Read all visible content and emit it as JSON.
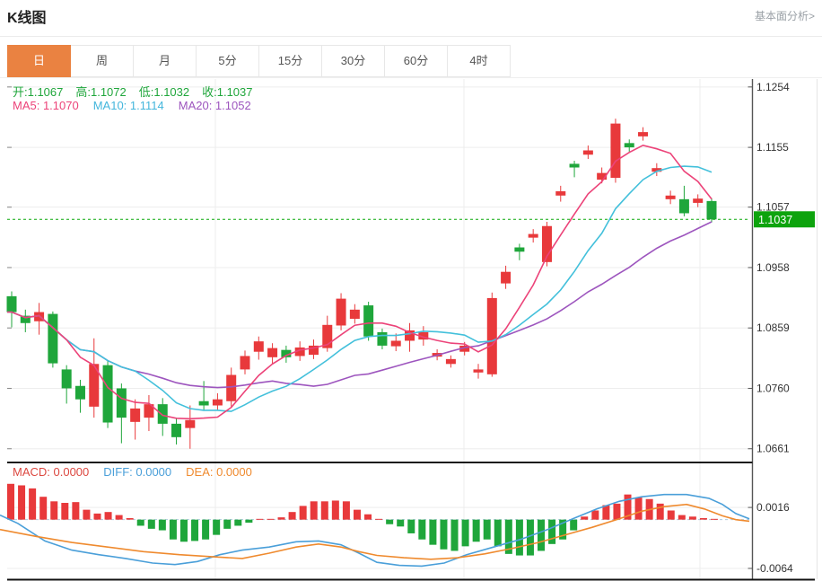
{
  "header": {
    "title": "K线图",
    "link_label": "基本面分析>"
  },
  "tabs": {
    "items": [
      "日",
      "周",
      "月",
      "5分",
      "15分",
      "30分",
      "60分",
      "4时"
    ],
    "active": "日"
  },
  "legend": {
    "ohlc": [
      "开:1.1067",
      "高:1.1072",
      "低:1.1032",
      "收:1.1037"
    ],
    "ma": [
      "MA5: 1.1070",
      "MA10: 1.1114",
      "MA20: 1.1052"
    ]
  },
  "macd_legend": [
    "MACD: 0.0000",
    "DIFF: 0.0000",
    "DEA: 0.0000"
  ],
  "current_price": "1.1037",
  "colors": {
    "up": "#E8393B",
    "down": "#1FA63B",
    "ma5": "#EC4379",
    "ma10": "#43C0DB",
    "ma20": "#9D55BE",
    "diff": "#4A9FD9",
    "dea": "#EF8A2E",
    "tab_active": "#EA8241",
    "price_badge": "#0DA30D",
    "price_line": "#0BA90B",
    "grid": "#ededed",
    "axis": "#555555",
    "label": "#333333",
    "zero_dash": "#AECBDF"
  },
  "chart_data": [
    {
      "type": "candlestick",
      "title": "K线图 日K",
      "ylim": [
        1.064,
        1.1267
      ],
      "y_ticks": [
        1.1254,
        1.1155,
        1.1057,
        1.0958,
        1.0859,
        1.076,
        1.0661
      ],
      "y_tick_labels": [
        "1.1254",
        "1.1155",
        "1.1057",
        "1.0958",
        "1.0859",
        "1.0760",
        "1.0661"
      ],
      "current_price": 1.1037,
      "ma_periods": [
        5,
        10,
        20
      ],
      "last_ohlc": {
        "open": 1.1067,
        "high": 1.1072,
        "low": 1.1032,
        "close": 1.1037
      },
      "ohlc": [
        [
          1.0911,
          1.0919,
          1.086,
          1.0885
        ],
        [
          1.0879,
          1.0889,
          1.0852,
          1.0867
        ],
        [
          1.087,
          1.09,
          1.0848,
          1.0885
        ],
        [
          1.0882,
          1.0886,
          1.0794,
          1.0801
        ],
        [
          1.0791,
          1.0798,
          1.0735,
          1.076
        ],
        [
          1.0764,
          1.0774,
          1.072,
          1.0742
        ],
        [
          1.073,
          1.0842,
          1.0712,
          1.08
        ],
        [
          1.0798,
          1.0806,
          1.0695,
          1.0704
        ],
        [
          1.076,
          1.0768,
          1.067,
          1.0712
        ],
        [
          1.0705,
          1.0742,
          1.0676,
          1.0727
        ],
        [
          1.0712,
          1.0749,
          1.069,
          1.0734
        ],
        [
          1.0734,
          1.0744,
          1.0682,
          1.0702
        ],
        [
          1.0702,
          1.0712,
          1.0668,
          1.068
        ],
        [
          1.0695,
          1.0732,
          1.0661,
          1.0708
        ],
        [
          1.0739,
          1.0772,
          1.0723,
          1.0732
        ],
        [
          1.0732,
          1.0752,
          1.0724,
          1.0742
        ],
        [
          1.0739,
          1.0794,
          1.073,
          1.0782
        ],
        [
          1.0791,
          1.0822,
          1.0783,
          1.0813
        ],
        [
          1.082,
          1.0845,
          1.0807,
          1.0837
        ],
        [
          1.0811,
          1.0834,
          1.08,
          1.0826
        ],
        [
          1.0823,
          1.083,
          1.0802,
          1.0811
        ],
        [
          1.0813,
          1.0837,
          1.0805,
          1.0827
        ],
        [
          1.0815,
          1.084,
          1.0808,
          1.083
        ],
        [
          1.0826,
          1.0879,
          1.082,
          1.0864
        ],
        [
          1.0863,
          1.0916,
          1.0855,
          1.0907
        ],
        [
          1.0874,
          1.0898,
          1.0866,
          1.0889
        ],
        [
          1.0896,
          1.0902,
          1.0838,
          1.0845
        ],
        [
          1.0852,
          1.0858,
          1.0824,
          1.083
        ],
        [
          1.0829,
          1.085,
          1.0821,
          1.0838
        ],
        [
          1.0838,
          1.0867,
          1.082,
          1.0855
        ],
        [
          1.084,
          1.0862,
          1.083,
          1.0852
        ],
        [
          1.0812,
          1.0824,
          1.0806,
          1.0818
        ],
        [
          1.08,
          1.0814,
          1.0794,
          1.0808
        ],
        [
          1.082,
          1.0836,
          1.0814,
          1.083
        ],
        [
          1.0786,
          1.08,
          1.0776,
          1.0791
        ],
        [
          1.0783,
          1.0917,
          1.0779,
          1.0908
        ],
        [
          1.0932,
          1.0961,
          1.0923,
          1.0951
        ],
        [
          1.0991,
          1.0997,
          1.097,
          1.0984
        ],
        [
          1.1007,
          1.1021,
          1.0999,
          1.1013
        ],
        [
          1.0967,
          1.1033,
          1.096,
          1.1026
        ],
        [
          1.1076,
          1.1092,
          1.1066,
          1.1083
        ],
        [
          1.1128,
          1.1133,
          1.1106,
          1.1122
        ],
        [
          1.1143,
          1.1158,
          1.1136,
          1.115
        ],
        [
          1.1102,
          1.1122,
          1.1096,
          1.1113
        ],
        [
          1.1105,
          1.1202,
          1.1097,
          1.1194
        ],
        [
          1.1162,
          1.1168,
          1.1148,
          1.1155
        ],
        [
          1.1173,
          1.1188,
          1.1166,
          1.118
        ],
        [
          1.1115,
          1.1129,
          1.1108,
          1.1121
        ],
        [
          1.107,
          1.1084,
          1.1062,
          1.1076
        ],
        [
          1.107,
          1.1092,
          1.1042,
          1.1047
        ],
        [
          1.1064,
          1.1078,
          1.1057,
          1.1071
        ],
        [
          1.1067,
          1.1072,
          1.1032,
          1.1037
        ]
      ]
    },
    {
      "type": "bar",
      "name": "MACD",
      "ylim": [
        -0.0077,
        0.0055
      ],
      "y_ticks": [
        0.0016,
        -0.0064
      ],
      "y_tick_labels": [
        "0.0016",
        "-0.0064"
      ],
      "values": [
        0.0047,
        0.0045,
        0.0041,
        0.003,
        0.0024,
        0.0022,
        0.0023,
        0.0013,
        0.0008,
        0.001,
        0.0006,
        0.0002,
        -0.0008,
        -0.0012,
        -0.0014,
        -0.0026,
        -0.0029,
        -0.0028,
        -0.0026,
        -0.002,
        -0.0012,
        -0.0008,
        -0.0004,
        0.0001,
        0.0001,
        0.0003,
        0.001,
        0.0018,
        0.0024,
        0.0024,
        0.0025,
        0.0024,
        0.0013,
        0.0007,
        0.0001,
        -0.0006,
        -0.0009,
        -0.0018,
        -0.0026,
        -0.0033,
        -0.0039,
        -0.0041,
        -0.0035,
        -0.0029,
        -0.0026,
        -0.0035,
        -0.0045,
        -0.0047,
        -0.0047,
        -0.0041,
        -0.0032,
        -0.0026,
        -0.0014,
        0.0004,
        0.0012,
        0.0019,
        0.0021,
        0.0033,
        0.0029,
        0.0027,
        0.0021,
        0.0012,
        0.0006,
        0.0004,
        0.0002,
        0.0001
      ],
      "diff_line": [
        [
          0,
          0.0006
        ],
        [
          20,
          -0.0005
        ],
        [
          50,
          -0.0028
        ],
        [
          80,
          -0.004
        ],
        [
          110,
          -0.0046
        ],
        [
          140,
          -0.0051
        ],
        [
          170,
          -0.0057
        ],
        [
          195,
          -0.0059
        ],
        [
          220,
          -0.0055
        ],
        [
          245,
          -0.0046
        ],
        [
          270,
          -0.004
        ],
        [
          300,
          -0.0036
        ],
        [
          330,
          -0.0029
        ],
        [
          355,
          -0.0028
        ],
        [
          380,
          -0.0033
        ],
        [
          400,
          -0.0044
        ],
        [
          420,
          -0.0056
        ],
        [
          445,
          -0.006
        ],
        [
          470,
          -0.0061
        ],
        [
          495,
          -0.0057
        ],
        [
          520,
          -0.0046
        ],
        [
          550,
          -0.0036
        ],
        [
          580,
          -0.0026
        ],
        [
          610,
          -0.0013
        ],
        [
          640,
          0.0002
        ],
        [
          665,
          0.0014
        ],
        [
          690,
          0.0024
        ],
        [
          715,
          0.003
        ],
        [
          740,
          0.0033
        ],
        [
          765,
          0.0033
        ],
        [
          790,
          0.0028
        ],
        [
          805,
          0.002
        ],
        [
          820,
          0.0008
        ],
        [
          835,
          0.0001
        ]
      ],
      "dea_line": [
        [
          0,
          -0.0013
        ],
        [
          40,
          -0.0022
        ],
        [
          80,
          -0.003
        ],
        [
          120,
          -0.0036
        ],
        [
          160,
          -0.0042
        ],
        [
          200,
          -0.0046
        ],
        [
          240,
          -0.0049
        ],
        [
          270,
          -0.0051
        ],
        [
          300,
          -0.0044
        ],
        [
          330,
          -0.0036
        ],
        [
          355,
          -0.0032
        ],
        [
          380,
          -0.0036
        ],
        [
          400,
          -0.0042
        ],
        [
          420,
          -0.0047
        ],
        [
          450,
          -0.005
        ],
        [
          480,
          -0.0052
        ],
        [
          510,
          -0.005
        ],
        [
          540,
          -0.0045
        ],
        [
          570,
          -0.0038
        ],
        [
          600,
          -0.003
        ],
        [
          630,
          -0.002
        ],
        [
          660,
          -0.001
        ],
        [
          690,
          0.0001
        ],
        [
          715,
          0.0011
        ],
        [
          740,
          0.0017
        ],
        [
          765,
          0.002
        ],
        [
          785,
          0.0014
        ],
        [
          805,
          0.0005
        ],
        [
          820,
          0.0
        ],
        [
          835,
          -0.0002
        ]
      ]
    }
  ]
}
